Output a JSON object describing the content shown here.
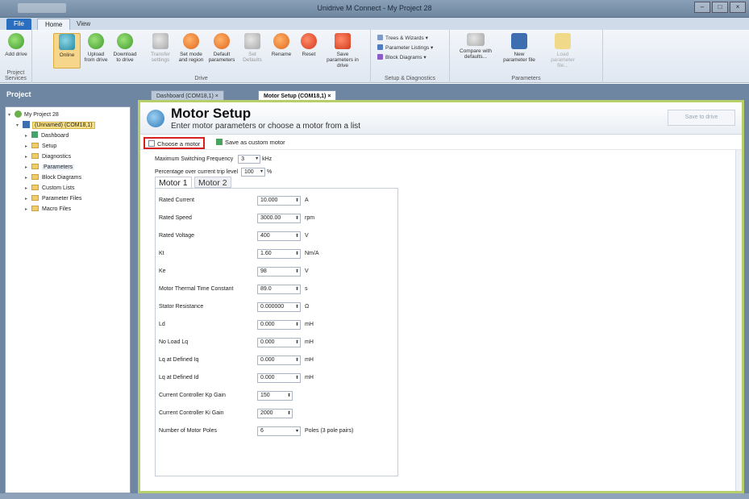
{
  "window": {
    "title": "Unidrive M Connect - My Project 28",
    "controls": [
      "–",
      "□",
      "×"
    ]
  },
  "ribbon_tabs": [
    "File",
    "Home",
    "View"
  ],
  "ribbon": {
    "project_services": {
      "label": "Project Services",
      "buttons": [
        {
          "label": "Add drive",
          "icon": "add-drive-icon"
        }
      ]
    },
    "drive": {
      "label": "Drive",
      "buttons": [
        {
          "label": "Online",
          "icon": "online-icon",
          "active": true
        },
        {
          "label": "Upload from drive",
          "icon": "upload-icon"
        },
        {
          "label": "Download to drive",
          "icon": "download-icon"
        },
        {
          "label": "Transfer settings",
          "icon": "transfer-icon"
        },
        {
          "label": "Set mode and region",
          "icon": "set-mode-icon"
        },
        {
          "label": "Default parameters",
          "icon": "default-params-icon"
        },
        {
          "label": "Set Defaults",
          "icon": "set-defaults-icon"
        },
        {
          "label": "Rename",
          "icon": "rename-icon"
        },
        {
          "label": "Reset",
          "icon": "reset-icon"
        },
        {
          "label": "Save parameters in drive",
          "icon": "save-params-icon"
        }
      ]
    },
    "setup": {
      "label": "Setup & Diagnostics",
      "items": [
        "Trees & Wizards",
        "Parameter Listings",
        "Block Diagrams"
      ]
    },
    "parameters": {
      "label": "Parameters",
      "buttons": [
        {
          "label": "Compare with defaults...",
          "icon": "compare-icon"
        },
        {
          "label": "New parameter file",
          "icon": "new-param-file-icon"
        },
        {
          "label": "Load parameter file...",
          "icon": "load-param-file-icon"
        }
      ]
    }
  },
  "project_panel": {
    "header": "Project",
    "tree": [
      {
        "label": "My Project 28",
        "level": 0,
        "kind": "project",
        "expander": "▾"
      },
      {
        "label": "(Unnamed) (COM18,1)",
        "level": 1,
        "kind": "drive",
        "expander": "▾",
        "selected": true
      },
      {
        "label": "Dashboard",
        "level": 2,
        "kind": "dashboard",
        "expander": "▸"
      },
      {
        "label": "Setup",
        "level": 2,
        "kind": "folder",
        "expander": "▸"
      },
      {
        "label": "Diagnostics",
        "level": 2,
        "kind": "folder",
        "expander": "▸"
      },
      {
        "label": "Parameters",
        "level": 2,
        "kind": "folder",
        "expander": "▸",
        "hover": true
      },
      {
        "label": "Block Diagrams",
        "level": 2,
        "kind": "folder",
        "expander": "▸"
      },
      {
        "label": "Custom Lists",
        "level": 2,
        "kind": "folder",
        "expander": "▸"
      },
      {
        "label": "Parameter Files",
        "level": 2,
        "kind": "folder",
        "expander": "▸"
      },
      {
        "label": "Macro Files",
        "level": 2,
        "kind": "folder",
        "expander": "▸"
      }
    ]
  },
  "doc_tabs": [
    {
      "label": "Dashboard (COM18,1)",
      "close": "×",
      "active": false
    },
    {
      "label": "Motor Setup (COM18,1)",
      "close": "×",
      "active": true
    }
  ],
  "motor_setup": {
    "title": "Motor Setup",
    "subtitle": "Enter motor parameters or choose a motor from a list",
    "save_button": "Save to drive",
    "actions": {
      "choose": "Choose a motor",
      "save_custom": "Save as custom motor"
    },
    "switching_freq": {
      "label": "Maximum Switching Frequency",
      "value": "3",
      "unit": "kHz"
    },
    "overcurrent": {
      "label": "Percentage over current trip level",
      "value": "100",
      "unit": "%"
    },
    "motor_tabs": [
      "Motor 1",
      "Motor 2"
    ],
    "params": [
      {
        "label": "Rated Current",
        "value": "10.000",
        "unit": "A"
      },
      {
        "label": "Rated Speed",
        "value": "3000.00",
        "unit": "rpm"
      },
      {
        "label": "Rated Voltage",
        "value": "400",
        "unit": "V"
      },
      {
        "label": "Kt",
        "value": "1.60",
        "unit": "Nm/A"
      },
      {
        "label": "Ke",
        "value": "98",
        "unit": "V"
      },
      {
        "label": "Motor Thermal Time Constant",
        "value": "89.0",
        "unit": "s"
      },
      {
        "label": "Stator Resistance",
        "value": "0.000000",
        "unit": "Ω"
      },
      {
        "label": "Ld",
        "value": "0.000",
        "unit": "mH"
      },
      {
        "label": "No Load Lq",
        "value": "0.000",
        "unit": "mH"
      },
      {
        "label": "Lq at Defined Iq",
        "value": "0.000",
        "unit": "mH"
      },
      {
        "label": "Lq at Defined Id",
        "value": "0.000",
        "unit": "mH"
      },
      {
        "label": "Current Controller Kp Gain",
        "value": "150",
        "unit": ""
      },
      {
        "label": "Current Controller Ki Gain",
        "value": "2000",
        "unit": ""
      }
    ],
    "poles": {
      "label": "Number of Motor Poles",
      "value": "6",
      "unit": "Poles (3 pole pairs)"
    }
  }
}
